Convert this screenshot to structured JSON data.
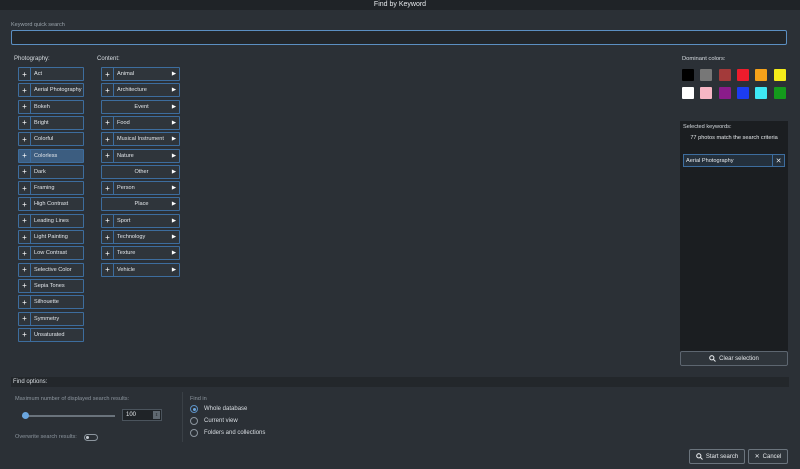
{
  "window": {
    "title": "Find by Keyword"
  },
  "quick_search": {
    "label": "Keyword quick search",
    "value": "",
    "placeholder": ""
  },
  "photography": {
    "label": "Photography:",
    "items": [
      {
        "label": "Act"
      },
      {
        "label": "Aerial Photography"
      },
      {
        "label": "Bokeh"
      },
      {
        "label": "Bright"
      },
      {
        "label": "Colorful"
      },
      {
        "label": "Colorless",
        "selected": true
      },
      {
        "label": "Dark"
      },
      {
        "label": "Framing"
      },
      {
        "label": "High Contrast"
      },
      {
        "label": "Leading Lines"
      },
      {
        "label": "Light Painting"
      },
      {
        "label": "Low Contrast"
      },
      {
        "label": "Selective Color"
      },
      {
        "label": "Sepia Tones"
      },
      {
        "label": "Silhouette"
      },
      {
        "label": "Symmetry"
      },
      {
        "label": "Unsaturated"
      }
    ]
  },
  "content": {
    "label": "Content:",
    "items": [
      {
        "label": "Animal",
        "plus": true
      },
      {
        "label": "Architecture",
        "plus": true
      },
      {
        "label": "Event",
        "plus": false
      },
      {
        "label": "Food",
        "plus": true
      },
      {
        "label": "Musical Instrument",
        "plus": true
      },
      {
        "label": "Nature",
        "plus": true
      },
      {
        "label": "Other",
        "plus": false
      },
      {
        "label": "Person",
        "plus": true
      },
      {
        "label": "Place",
        "plus": false
      },
      {
        "label": "Sport",
        "plus": true
      },
      {
        "label": "Technology",
        "plus": true
      },
      {
        "label": "Texture",
        "plus": true
      },
      {
        "label": "Vehicle",
        "plus": true
      }
    ]
  },
  "dominant_colors": {
    "label": "Dominant colors:",
    "swatches": [
      "#000000",
      "#777777",
      "#a33a3a",
      "#ee1c2c",
      "#f5a21a",
      "#f4ec1a",
      "#ffffff",
      "#f7b6c4",
      "#8a1c8a",
      "#1c3cf0",
      "#3ee8f5",
      "#149a1c"
    ]
  },
  "selected_keywords": {
    "label": "Selected keywords:",
    "match_text": "77 photos match the search criteria",
    "items": [
      {
        "label": "Aerial Photography"
      }
    ],
    "clear_label": "Clear selection"
  },
  "find_options": {
    "label": "Find options:",
    "max_results_label": "Maximum number of displayed search results:",
    "max_results_value": "100",
    "slider_fraction": 0.02,
    "overwrite_label": "Overwrite search results:",
    "overwrite_toggle_text": "",
    "find_in_label": "Find in",
    "find_in_options": [
      {
        "label": "Whole database",
        "checked": true
      },
      {
        "label": "Current view",
        "checked": false
      },
      {
        "label": "Folders and collections",
        "checked": false
      }
    ]
  },
  "buttons": {
    "start_search": "Start search",
    "cancel": "Cancel"
  }
}
